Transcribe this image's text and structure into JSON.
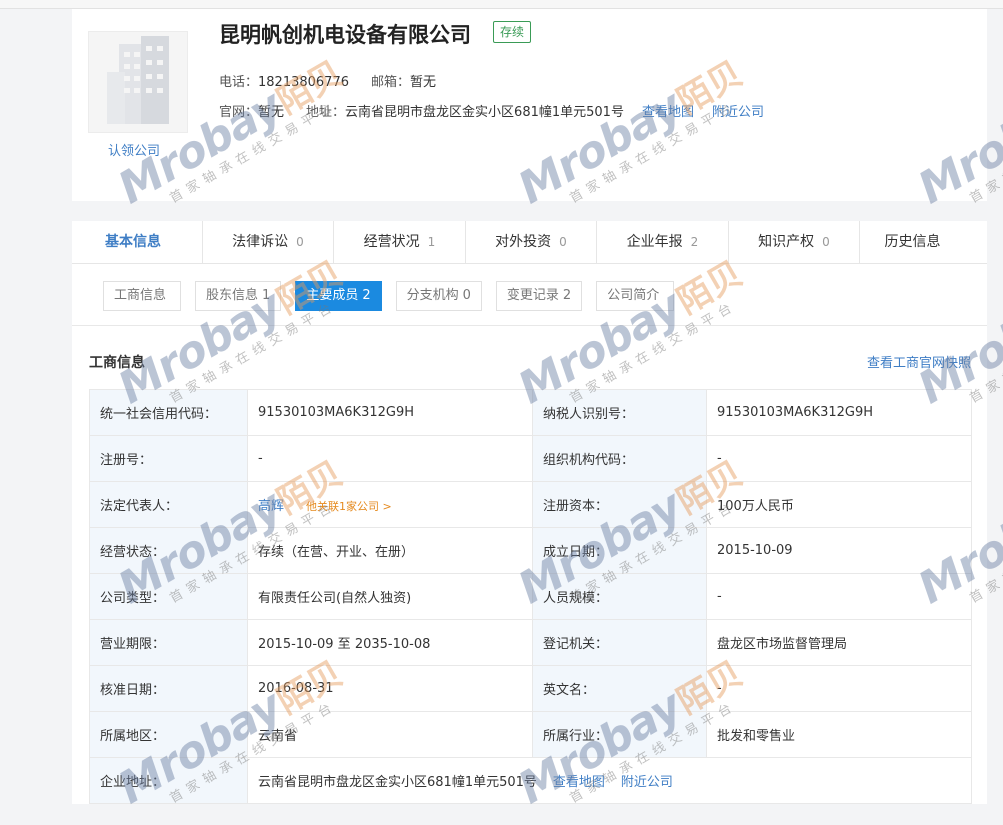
{
  "company": {
    "name": "昆明帆创机电设备有限公司",
    "status": "存续",
    "claim": "认领公司",
    "phone_label": "电话：",
    "phone": "18213806776",
    "email_label": "邮箱：",
    "email": "暂无",
    "website_label": "官网：",
    "website": "暂无",
    "address_label": "地址：",
    "address": "云南省昆明市盘龙区金实小区681幢1单元501号",
    "map_link": "查看地图",
    "nearby_link": "附近公司"
  },
  "main_tabs": [
    {
      "label": "基本信息",
      "count": ""
    },
    {
      "label": "法律诉讼",
      "count": "0"
    },
    {
      "label": "经营状况",
      "count": "1"
    },
    {
      "label": "对外投资",
      "count": "0"
    },
    {
      "label": "企业年报",
      "count": "2"
    },
    {
      "label": "知识产权",
      "count": "0"
    },
    {
      "label": "历史信息",
      "count": ""
    }
  ],
  "sub_tabs": [
    {
      "label": "工商信息",
      "count": ""
    },
    {
      "label": "股东信息",
      "count": "1"
    },
    {
      "label": "主要成员",
      "count": "2"
    },
    {
      "label": "分支机构",
      "count": "0"
    },
    {
      "label": "变更记录",
      "count": "2"
    },
    {
      "label": "公司简介",
      "count": ""
    }
  ],
  "section": {
    "title": "工商信息",
    "snapshot_link": "查看工商官网快照"
  },
  "table": {
    "rows": [
      [
        "统一社会信用代码：",
        "91530103MA6K312G9H",
        "纳税人识别号：",
        "91530103MA6K312G9H"
      ],
      [
        "注册号：",
        "-",
        "组织机构代码：",
        "-"
      ],
      [
        "法定代表人：",
        "高辉",
        "注册资本：",
        "100万人民币"
      ],
      [
        "经营状态：",
        "存续（在营、开业、在册）",
        "成立日期：",
        "2015-10-09"
      ],
      [
        "公司类型：",
        "有限责任公司(自然人独资)",
        "人员规模：",
        "-"
      ],
      [
        "营业期限：",
        "2015-10-09 至 2035-10-08",
        "登记机关：",
        "盘龙区市场监督管理局"
      ],
      [
        "核准日期：",
        "2016-08-31",
        "英文名：",
        "-"
      ],
      [
        "所属地区：",
        "云南省",
        "所属行业：",
        "批发和零售业"
      ]
    ],
    "legal_rep_related": "他关联1家公司 >",
    "address_row": {
      "label": "企业地址：",
      "value": "云南省昆明市盘龙区金实小区681幢1单元501号",
      "map_link": "查看地图",
      "nearby_link": "附近公司"
    }
  },
  "watermark": {
    "brand": "Mrobay",
    "brand_cn": "陌贝",
    "tagline": "首家轴承在线交易平台"
  }
}
